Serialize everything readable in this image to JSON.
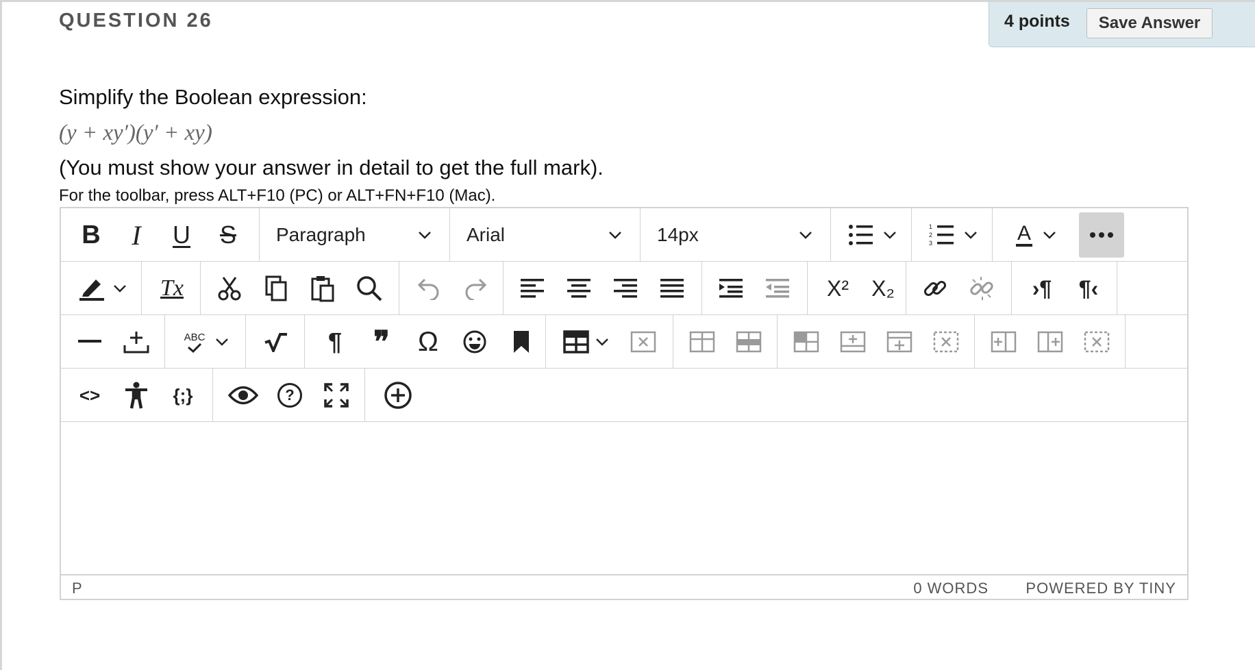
{
  "question": {
    "title": "QUESTION 26",
    "points": "4 points",
    "save_label": "Save Answer",
    "prompt": "Simplify the Boolean expression:",
    "expression": "(y + xy′)(y′ + xy)",
    "note": "(You must show your answer in detail to get the full mark).",
    "toolbar_hint": "For the toolbar, press ALT+F10 (PC) or ALT+FN+F10 (Mac)."
  },
  "editor": {
    "block_format": "Paragraph",
    "font_family": "Arial",
    "font_size": "14px",
    "bold_glyph": "B",
    "italic_glyph": "I",
    "underline_glyph": "U",
    "strike_glyph": "S",
    "text_color_glyph": "A",
    "clear_format_glyph": "Tx",
    "superscript_glyph": "X²",
    "subscript_glyph": "X₂",
    "ltr_glyph": "›¶",
    "rtl_glyph": "¶‹",
    "paragraph_glyph": "¶",
    "quote_glyph": "❞",
    "omega_glyph": "Ω",
    "spell_glyph": "ABC",
    "code_glyph": "<>",
    "template_glyph": "{;}",
    "help_glyph": "?",
    "status_path": "P",
    "word_count": "0 WORDS",
    "powered_by": "POWERED BY TINY"
  },
  "colors": {
    "points_bg": "#dbe9ef",
    "border": "#d2d2d2",
    "active_button": "#d3d3d3",
    "icon": "#222222",
    "disabled_icon": "#9a9a9a"
  }
}
